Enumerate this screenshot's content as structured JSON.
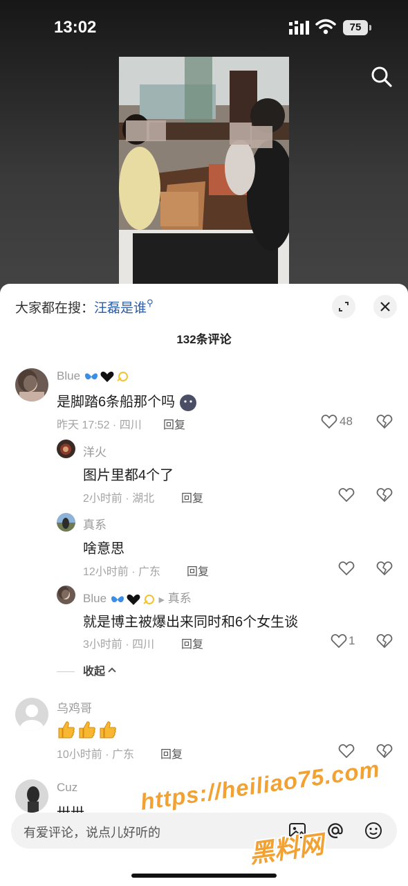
{
  "status_bar": {
    "time": "13:02",
    "battery": "75"
  },
  "sheet": {
    "hot_search_prefix": "大家都在搜：",
    "hot_search_keyword": "汪磊是谁",
    "comment_count_label": "132条评论",
    "collapse_label": "收起"
  },
  "comments": [
    {
      "username": "Blue",
      "text": "是脚踏6条船那个吗",
      "meta": "昨天 17:52 · 四川",
      "reply_label": "回复",
      "likes": "48"
    },
    {
      "username": "洋火",
      "text": "图片里都4个了",
      "meta": "2小时前 · 湖北",
      "reply_label": "回复",
      "likes": ""
    },
    {
      "username": "真系",
      "text": "啥意思",
      "meta": "12小时前 · 广东",
      "reply_label": "回复",
      "likes": ""
    },
    {
      "username": "Blue",
      "reply_to": "真系",
      "text": "就是博主被爆出来同时和6个女生谈",
      "meta": "3小时前 · 四川",
      "reply_label": "回复",
      "likes": "1"
    },
    {
      "username": "乌鸡哥",
      "text": "",
      "meta": "10小时前 · 广东",
      "reply_label": "回复",
      "likes": ""
    },
    {
      "username": "Cuz",
      "text": "卅卅",
      "meta": "",
      "reply_label": "",
      "likes": ""
    }
  ],
  "input": {
    "placeholder": "有爱评论，说点儿好听的"
  },
  "watermark": {
    "url": "https://heiliao75.com",
    "name": "黑料网"
  },
  "icons": [
    "signal-icon",
    "wifi-icon",
    "battery-icon",
    "search-icon",
    "expand-icon",
    "close-icon",
    "heart-icon",
    "broken-heart-icon",
    "image-icon",
    "at-icon",
    "emoji-icon"
  ]
}
